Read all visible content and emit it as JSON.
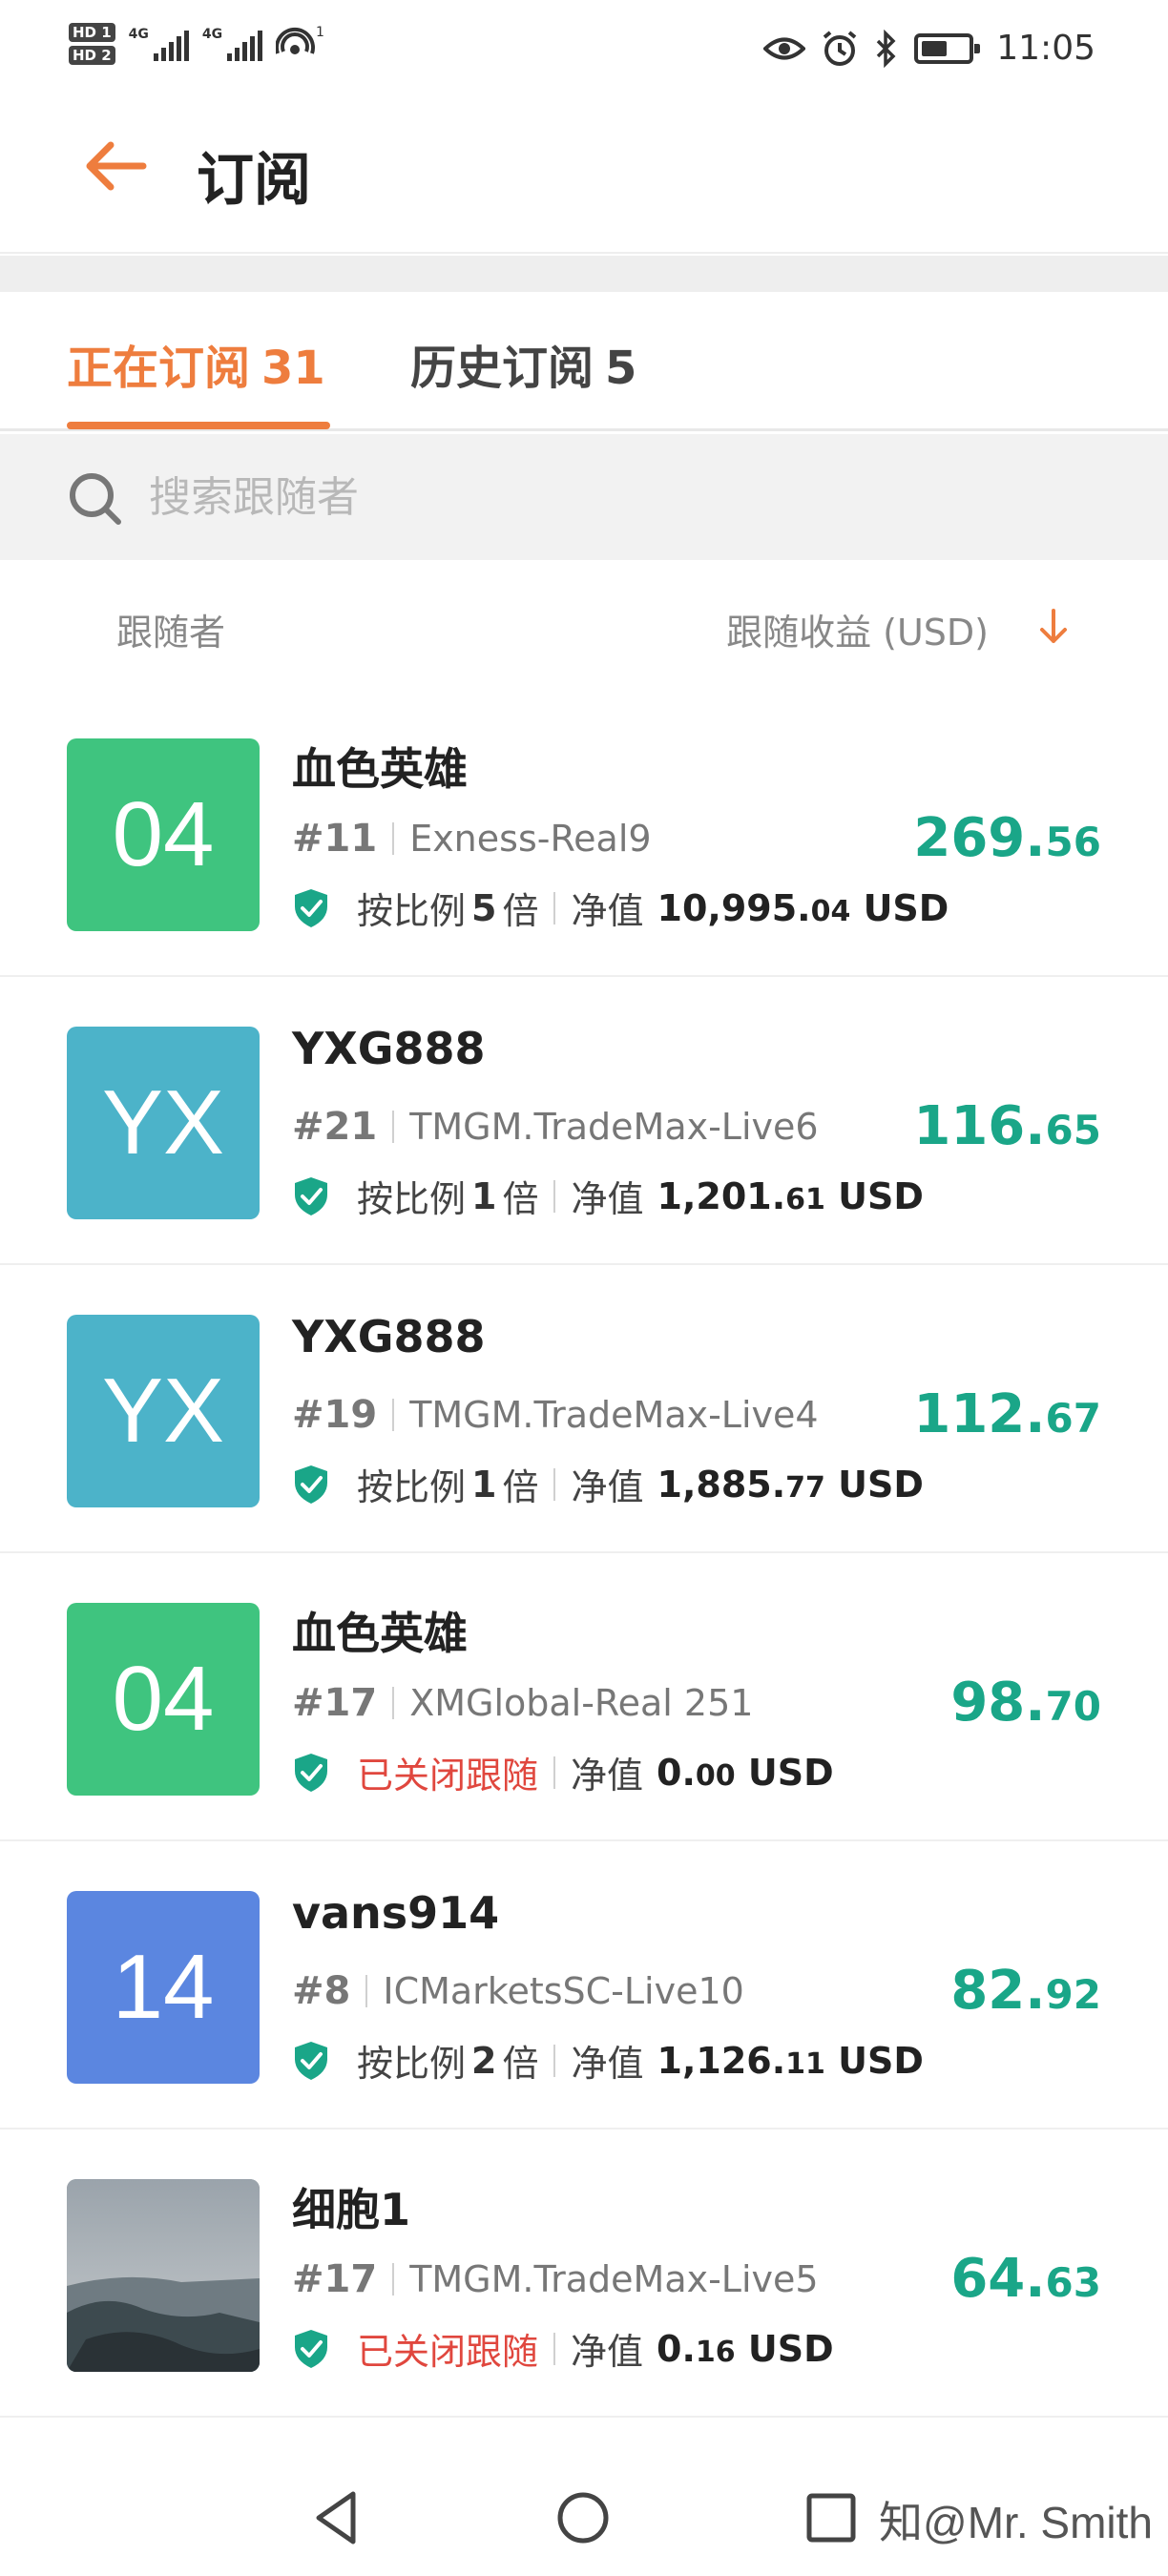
{
  "status_bar": {
    "hd1": "HD 1",
    "hd2": "HD 2",
    "signal1_label": "4G",
    "signal2_label": "4G",
    "hotspot_badge": "1",
    "time": "11:05"
  },
  "header": {
    "title": "订阅"
  },
  "tabs": [
    {
      "label": "正在订阅",
      "count": "31",
      "active": true
    },
    {
      "label": "历史订阅",
      "count": "5",
      "active": false
    }
  ],
  "search": {
    "placeholder": "搜索跟随者"
  },
  "columns": {
    "follower": "跟随者",
    "profit": "跟随收益 (USD)"
  },
  "items": [
    {
      "avatar_text": "04",
      "avatar_color": "#3fc47f",
      "name": "血色英雄",
      "rank": "#11",
      "account": "Exness-Real9",
      "closed": false,
      "status_prefix": "按比例",
      "multiplier": "5",
      "status_suffix": "倍",
      "equity_label": "净值",
      "equity_int": "10,995.",
      "equity_dec": "04",
      "currency": "USD",
      "profit_int": "269.",
      "profit_dec": "56"
    },
    {
      "avatar_text": "YX",
      "avatar_color": "#4cb3c9",
      "name": "YXG888",
      "rank": "#21",
      "account": "TMGM.TradeMax-Live6",
      "closed": false,
      "status_prefix": "按比例",
      "multiplier": "1",
      "status_suffix": "倍",
      "equity_label": "净值",
      "equity_int": "1,201.",
      "equity_dec": "61",
      "currency": "USD",
      "profit_int": "116.",
      "profit_dec": "65"
    },
    {
      "avatar_text": "YX",
      "avatar_color": "#4cb3c9",
      "name": "YXG888",
      "rank": "#19",
      "account": "TMGM.TradeMax-Live4",
      "closed": false,
      "status_prefix": "按比例",
      "multiplier": "1",
      "status_suffix": "倍",
      "equity_label": "净值",
      "equity_int": "1,885.",
      "equity_dec": "77",
      "currency": "USD",
      "profit_int": "112.",
      "profit_dec": "67"
    },
    {
      "avatar_text": "04",
      "avatar_color": "#3fc47f",
      "name": "血色英雄",
      "rank": "#17",
      "account": "XMGlobal-Real 251",
      "closed": true,
      "status_text": "已关闭跟随",
      "equity_label": "净值",
      "equity_int": "0.",
      "equity_dec": "00",
      "currency": "USD",
      "profit_int": "98.",
      "profit_dec": "70"
    },
    {
      "avatar_text": "14",
      "avatar_color": "#5b86e0",
      "name": "vans914",
      "rank": "#8",
      "account": "ICMarketsSC-Live10",
      "closed": false,
      "status_prefix": "按比例",
      "multiplier": "2",
      "status_suffix": "倍",
      "equity_label": "净值",
      "equity_int": "1,126.",
      "equity_dec": "11",
      "currency": "USD",
      "profit_int": "82.",
      "profit_dec": "92"
    },
    {
      "avatar_text": "",
      "avatar_color": "#8a8f96",
      "avatar_photo": true,
      "name": "细胞1",
      "rank": "#17",
      "account": "TMGM.TradeMax-Live5",
      "closed": true,
      "status_text": "已关闭跟随",
      "equity_label": "净值",
      "equity_int": "0.",
      "equity_dec": "16",
      "currency": "USD",
      "profit_int": "64.",
      "profit_dec": "63"
    }
  ],
  "watermark": "知@Mr. Smith",
  "colors": {
    "accent": "#ee7d3e",
    "profit": "#1aa688",
    "closed": "#e0473e",
    "shield": "#1aa688"
  }
}
